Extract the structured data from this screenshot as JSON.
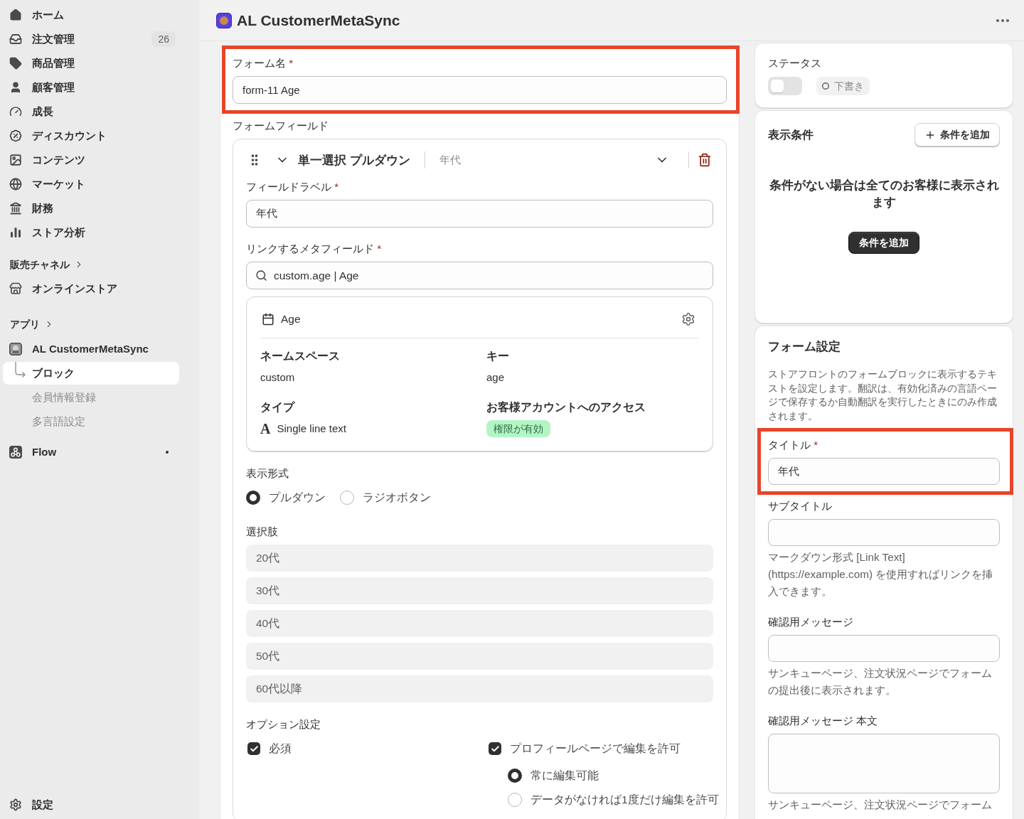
{
  "sidebar": {
    "nav": [
      {
        "label": "ホーム",
        "selected": false
      },
      {
        "label": "注文管理",
        "badge": "26",
        "selected": false
      },
      {
        "label": "商品管理",
        "selected": false
      },
      {
        "label": "顧客管理",
        "selected": false
      },
      {
        "label": "成長",
        "selected": false
      },
      {
        "label": "ディスカウント",
        "selected": false
      },
      {
        "label": "コンテンツ",
        "selected": false
      },
      {
        "label": "マーケット",
        "selected": false
      },
      {
        "label": "財務",
        "selected": false
      },
      {
        "label": "ストア分析",
        "selected": false
      }
    ],
    "sales_channels": {
      "title": "販売チャネル",
      "items": [
        {
          "label": "オンラインストア",
          "selected": false
        }
      ]
    },
    "apps": {
      "title": "アプリ",
      "items": [
        {
          "label": "AL CustomerMetaSync",
          "selected": false,
          "notification": false,
          "children": [
            {
              "label": "ブロック",
              "selected": true
            },
            {
              "label": "会員情報登録",
              "selected": false
            },
            {
              "label": "多言語設定",
              "selected": false
            }
          ]
        },
        {
          "label": "Flow",
          "selected": false,
          "notification": true
        }
      ]
    },
    "footer": {
      "label": "設定",
      "selected": false
    }
  },
  "header": {
    "title": "AL CustomerMetaSync"
  },
  "form": {
    "name_field": {
      "label": "フォーム名",
      "required_mark": "*",
      "value": "form-11 Age",
      "highlighted": true
    },
    "fields_heading": "フォームフィールド",
    "field": {
      "type": "単一選択 プルダウン",
      "summary": "年代",
      "expanded": true,
      "label_field": {
        "label": "フィールドラベル",
        "required_mark": "*",
        "value": "年代"
      },
      "metafield_field": {
        "label": "リンクするメタフィールド",
        "required_mark": "*",
        "value": "custom.age | Age"
      },
      "metafield": {
        "name": "Age",
        "details": [
          {
            "kind": "text",
            "label": "ネームスペース",
            "value": "custom"
          },
          {
            "kind": "text",
            "label": "キー",
            "value": "age"
          },
          {
            "kind": "type",
            "label": "タイプ",
            "icon_char": "A",
            "value": "Single line text"
          },
          {
            "kind": "badge",
            "label": "お客様アカウントへのアクセス",
            "value": "権限が有効"
          }
        ]
      },
      "display_format": {
        "label": "表示形式",
        "options": [
          {
            "label": "プルダウン",
            "selected": true
          },
          {
            "label": "ラジオボタン",
            "selected": false
          }
        ]
      },
      "choices": {
        "label": "選択肢",
        "items": [
          "20代",
          "30代",
          "40代",
          "50代",
          "60代以降"
        ]
      },
      "settings": {
        "label": "オプション設定",
        "options": [
          {
            "label": "必須",
            "checked": true
          },
          {
            "label": "プロフィールページで編集を許可",
            "checked": true,
            "modes": [
              {
                "label": "常に編集可能",
                "selected": true
              },
              {
                "label": "データがなければ1度だけ編集を許可",
                "selected": false
              }
            ]
          }
        ]
      }
    }
  },
  "status": {
    "label": "ステータス",
    "on": false,
    "badge": "下書き"
  },
  "display_conditions": {
    "title": "表示条件",
    "add_button": "条件を追加",
    "empty_message": "条件がない場合は全てのお客様に表示されます",
    "empty_button": "条件を追加"
  },
  "form_settings": {
    "title": "フォーム設定",
    "description": "ストアフロントのフォームブロックに表示するテキストを設定します。翻訳は、有効化済みの言語ページで保存するか自動翻訳を実行したときにのみ作成されます。",
    "fields": [
      {
        "kind": "input",
        "label": "タイトル",
        "required_mark": "*",
        "value": "年代",
        "highlighted": true
      },
      {
        "kind": "input",
        "label": "サブタイトル",
        "help": "マークダウン形式 [Link Text] (https://example.com) を使用すればリンクを挿入できます。",
        "highlighted": false
      },
      {
        "kind": "input",
        "label": "確認用メッセージ",
        "help": "サンキューページ、注文状況ページでフォームの提出後に表示されます。",
        "highlighted": false
      },
      {
        "kind": "textarea",
        "label": "確認用メッセージ 本文",
        "help": "サンキューページ、注文状況ページでフォーム",
        "highlighted": false
      }
    ]
  }
}
